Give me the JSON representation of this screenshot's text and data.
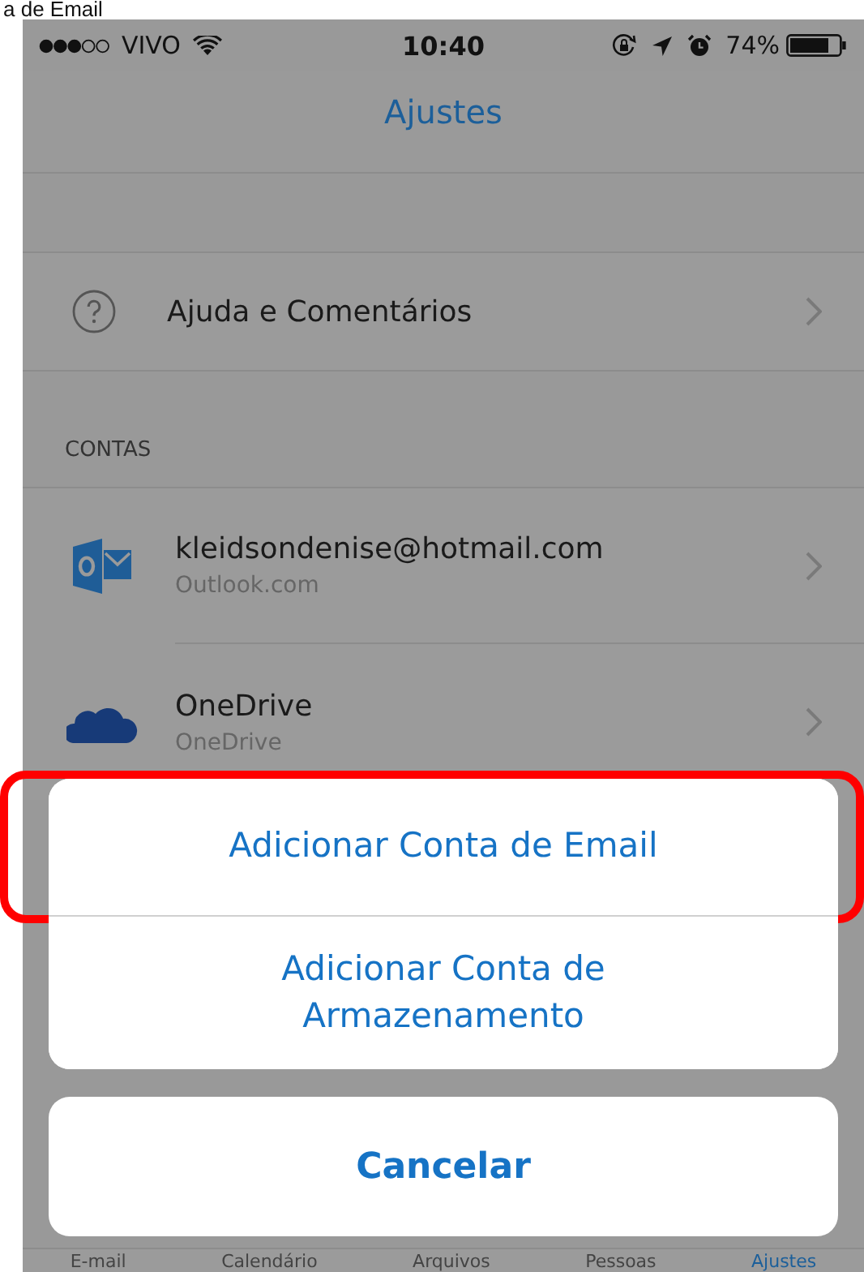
{
  "caption": "a de Email",
  "status_bar": {
    "carrier": "VIVO",
    "time": "10:40",
    "battery": "74%"
  },
  "nav": {
    "title": "Ajustes"
  },
  "help_row": {
    "kind": "help",
    "title": "Ajuda e Comentários"
  },
  "accounts": {
    "header": "CONTAS",
    "rows": [
      {
        "kind": "outlook",
        "title": "kleidsondenise@hotmail.com",
        "subtitle": "Outlook.com"
      },
      {
        "kind": "onedrive",
        "title": "OneDrive",
        "subtitle": "OneDrive"
      }
    ]
  },
  "action_sheet": {
    "options": [
      {
        "label": "Adicionar Conta de Email",
        "highlighted": true
      },
      {
        "label": "Adicionar Conta de Armazenamento",
        "highlighted": false
      }
    ],
    "cancel": "Cancelar"
  },
  "tab_bar": [
    {
      "label": "E-mail",
      "selected": false
    },
    {
      "label": "Calendário",
      "selected": false
    },
    {
      "label": "Arquivos",
      "selected": false
    },
    {
      "label": "Pessoas",
      "selected": false
    },
    {
      "label": "Ajustes",
      "selected": true
    }
  ]
}
